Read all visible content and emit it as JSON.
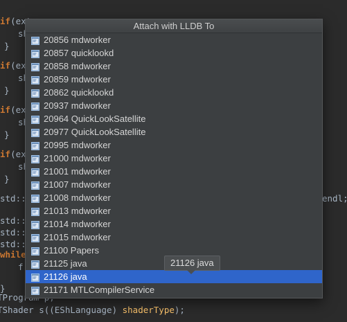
{
  "popup": {
    "title": "Attach with LLDB To",
    "processes": [
      {
        "label": "20856 mdworker"
      },
      {
        "label": "20857 quicklookd"
      },
      {
        "label": "20858 mdworker"
      },
      {
        "label": "20859 mdworker"
      },
      {
        "label": "20862 quicklookd"
      },
      {
        "label": "20937 mdworker"
      },
      {
        "label": "20964 QuickLookSatellite"
      },
      {
        "label": "20977 QuickLookSatellite"
      },
      {
        "label": "20995 mdworker"
      },
      {
        "label": "21000 mdworker"
      },
      {
        "label": "21001 mdworker"
      },
      {
        "label": "21007 mdworker"
      },
      {
        "label": "21008 mdworker"
      },
      {
        "label": "21013 mdworker"
      },
      {
        "label": "21014 mdworker"
      },
      {
        "label": "21015 mdworker"
      },
      {
        "label": "21100 Papers"
      },
      {
        "label": "21125 java"
      },
      {
        "label": "21126 java",
        "selected": true
      },
      {
        "label": "21171 MTLCompilerService"
      }
    ],
    "selected_color": "#2f65ca"
  },
  "tooltip": {
    "text": "21126 java"
  },
  "editor": {
    "lines": {
      "l1a": "if",
      "l1b": "(ext",
      "l1c": "sh",
      "l2": "}",
      "l3a": "if",
      "l3b": "(ext",
      "l3c": "sh",
      "l4": "}",
      "l5a": "if",
      "l5b": "(ext",
      "l5c": "sh",
      "l6": "}",
      "l7a": "if",
      "l7b": "(ext",
      "l7c": "sh",
      "l8": "}",
      "l9": "std::c",
      "l9end": "endl;",
      "l10": "std::i",
      "l11": "std::s",
      "l12": "std::s",
      "l13a": "while(",
      "l13b": "f",
      "l14": "}",
      "l15": "TProgram p;",
      "l16a": "TShader s((EShLanguage) ",
      "l16b": "shaderType",
      "l16c": ");"
    }
  },
  "icons": {
    "process": "process-window-icon"
  }
}
